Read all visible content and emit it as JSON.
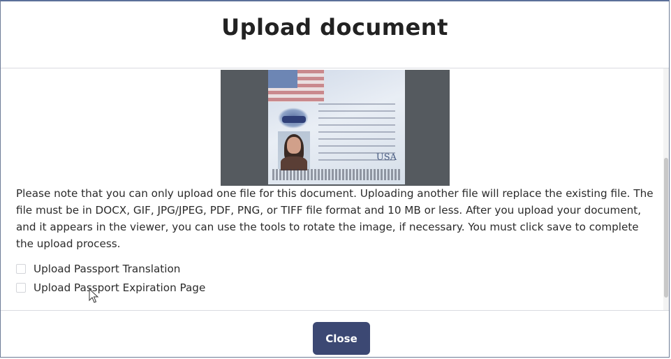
{
  "dialog": {
    "title": "Upload document",
    "instructions": "Please note that you can only upload one file for this document. Uploading another file will replace the existing file. The file must be in DOCX, GIF, JPG/JPEG, PDF, PNG, or TIFF file format and 10 MB or less. After you upload your document, and it appears in the viewer, you can use the tools to rotate the image, if necessary. You must click save to complete the upload process.",
    "options": [
      {
        "label": "Upload Passport Translation",
        "checked": false
      },
      {
        "label": "Upload Passport Expiration Page",
        "checked": false
      }
    ],
    "close_label": "Close"
  },
  "viewer": {
    "passport_country_mark": "USA"
  },
  "colors": {
    "primary_button": "#3c4873",
    "viewer_background": "#555a5f",
    "title_text": "#222222"
  }
}
